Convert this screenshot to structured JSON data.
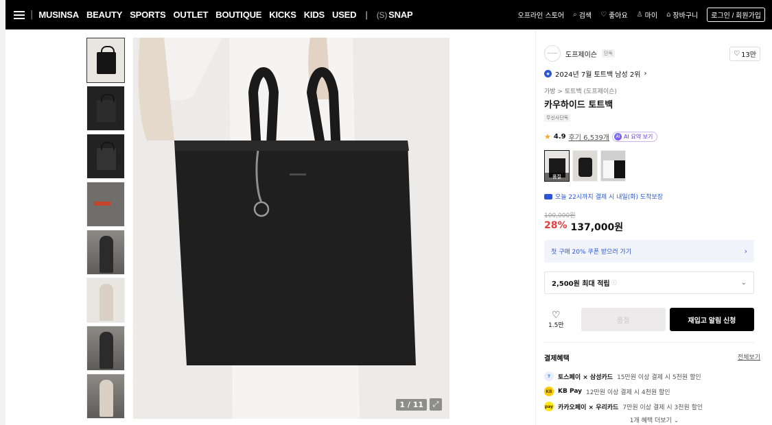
{
  "header": {
    "nav": [
      "MUSINSA",
      "BEAUTY",
      "SPORTS",
      "OUTLET",
      "BOUTIQUE",
      "KICKS",
      "KIDS",
      "USED"
    ],
    "snap_prefix": "(S)",
    "snap_label": "SNAP",
    "right": {
      "offline": "오프라인 스토어",
      "search": "검색",
      "like": "좋아요",
      "my": "마이",
      "cart": "장바구니",
      "login": "로그인 / 회원가입"
    }
  },
  "gallery": {
    "counter": "1 / 11"
  },
  "product": {
    "brand": "도프제이슨",
    "brand_tag": "단독",
    "like_count": "13만",
    "rank": "2024년 7월 토트백 남성 2위",
    "breadcrumb": "가방 > 토트백 (도프제이슨)",
    "title": "카우하이드 토트백",
    "small_tag": "무신사단독",
    "rating": "4.9",
    "reviews": "후기 6,539개",
    "ai_label": "AI 요약 보기",
    "ai_badge": "AI",
    "soldout_label": "품절",
    "delivery": "오늘 22시까지 결제 시 내일(화) 도착보장",
    "original_price": "100,000원",
    "discount": "28%",
    "price": "137,000원",
    "coupon": "첫 구매 20% 쿠폰 받으러 가기",
    "points": "2,500원 최대 적립",
    "wishlist_count": "1.5만",
    "buy_label": "품절",
    "notify_label": "재입고 알림 신청"
  },
  "benefits": {
    "title": "결제혜택",
    "all": "전체보기",
    "items": [
      {
        "strong": "토스페이 × 삼성카드",
        "text": "15만원 이상 결제 시 5천원 할인",
        "icon": "toss-pay-icon",
        "mark": "T"
      },
      {
        "strong": "KB Pay",
        "text": "12만원 이상 결제 시 4천원 할인",
        "icon": "kb-pay-icon",
        "mark": "KB"
      },
      {
        "strong": "카카오페이 × 우리카드",
        "text": "7만원 이상 결제 시 3천원 할인",
        "icon": "kakao-pay-icon",
        "mark": "pay"
      }
    ],
    "more": "1개 혜택 더보기"
  },
  "colors": {
    "accent_blue": "#2a56d6",
    "discount_red": "#e04040",
    "header_bg": "#000000"
  }
}
